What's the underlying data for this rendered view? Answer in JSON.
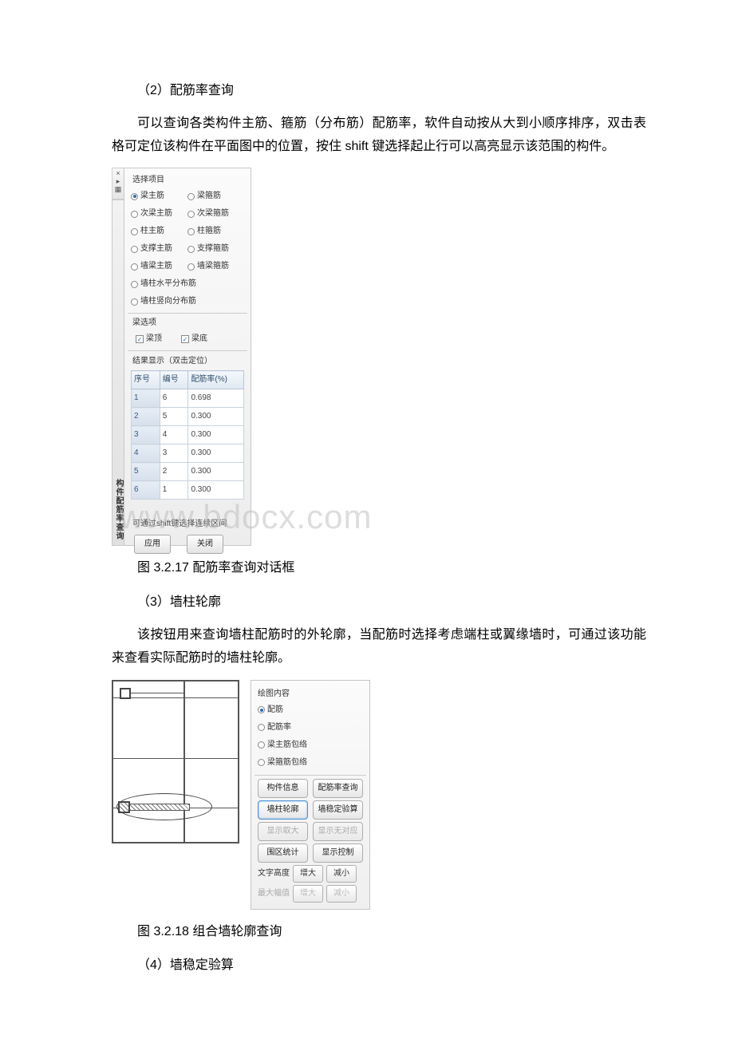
{
  "s1": {
    "h": "（2）配筋率查询",
    "p": "可以查询各类构件主筋、箍筋（分布筋）配筋率，软件自动按从大到小顺序排序，双击表格可定位该构件在平面图中的位置，按住 shift 键选择起止行可以高亮显示该范围的构件。"
  },
  "panel1": {
    "closeGlyphs": [
      "×",
      "▸",
      "▦"
    ],
    "title": "构件配筋率查询",
    "select_label": "选择项目",
    "radios": [
      {
        "label": "梁主筋",
        "sel": true
      },
      {
        "label": "梁箍筋"
      },
      {
        "label": "次梁主筋"
      },
      {
        "label": "次梁箍筋"
      },
      {
        "label": "柱主筋"
      },
      {
        "label": "柱箍筋"
      },
      {
        "label": "支撑主筋"
      },
      {
        "label": "支撑箍筋"
      },
      {
        "label": "墙梁主筋"
      },
      {
        "label": "墙梁箍筋"
      },
      {
        "label": "墙柱水平分布筋",
        "full": true
      },
      {
        "label": "墙柱竖向分布筋",
        "full": true
      }
    ],
    "sub_label": "梁选项",
    "chk1": "梁顶",
    "chk2": "梁底",
    "result_label": "结果显示（双击定位）",
    "cols": [
      "序号",
      "编号",
      "配筋率(%)"
    ],
    "rows": [
      [
        "1",
        "6",
        "0.698"
      ],
      [
        "2",
        "5",
        "0.300"
      ],
      [
        "3",
        "4",
        "0.300"
      ],
      [
        "4",
        "3",
        "0.300"
      ],
      [
        "5",
        "2",
        "0.300"
      ],
      [
        "6",
        "1",
        "0.300"
      ]
    ],
    "hint": "可通过shift键选择连续区间",
    "apply": "应用",
    "close": "关闭"
  },
  "watermark": "www.bdocx.com",
  "cap1": "图 3.2.17 配筋率查询对话框",
  "s2": {
    "h": "（3）墙柱轮廓",
    "p": "该按钮用来查询墙柱配筋时的外轮廓，当配筋时选择考虑端柱或翼缘墙时，可通过该功能来查看实际配筋时的墙柱轮廓。"
  },
  "panel2": {
    "grp": "绘图内容",
    "radios": [
      "配筋",
      "配筋率",
      "梁主筋包络",
      "梁箍筋包络"
    ],
    "btns1": [
      "构件信息",
      "配筋率查询"
    ],
    "btns2": [
      "墙柱轮廓",
      "墙稳定验算"
    ],
    "btns3": [
      "显示取大",
      "显示无对应"
    ],
    "btns4": [
      "围区统计",
      "显示控制"
    ],
    "t1_label": "文字高度",
    "t1a": "增大",
    "t1b": "减小",
    "t2_label": "最大幅值",
    "t2a": "增大",
    "t2b": "减小"
  },
  "cap2": "图 3.2.18 组合墙轮廓查询",
  "s3": {
    "h": "（4）墙稳定验算"
  },
  "chart_data": {
    "type": "table",
    "columns": [
      "序号",
      "编号",
      "配筋率(%)"
    ],
    "rows": [
      [
        "1",
        "6",
        0.698
      ],
      [
        "2",
        "5",
        0.3
      ],
      [
        "3",
        "4",
        0.3
      ],
      [
        "4",
        "3",
        0.3
      ],
      [
        "5",
        "2",
        0.3
      ],
      [
        "6",
        "1",
        0.3
      ]
    ]
  }
}
